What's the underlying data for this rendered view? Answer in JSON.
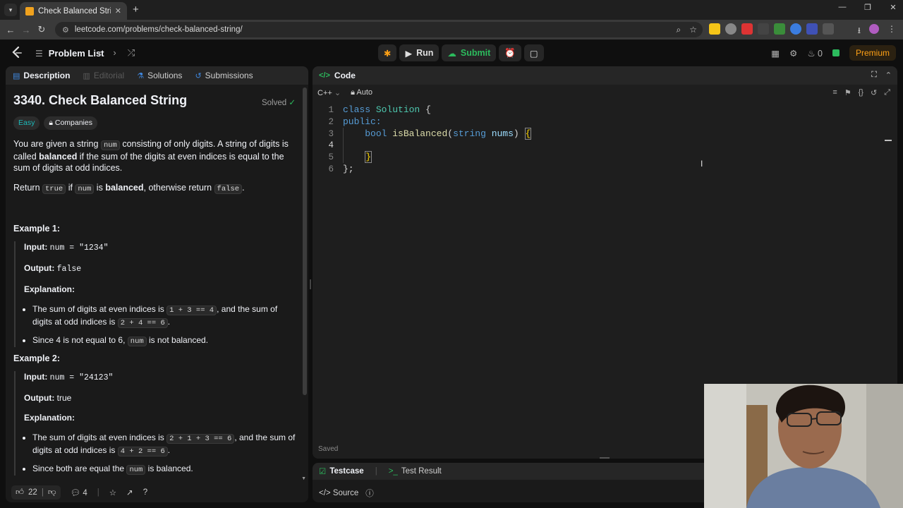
{
  "browser": {
    "tab_title": "Check Balanced String - LeetCo",
    "url": "leetcode.com/problems/check-balanced-string/"
  },
  "nav": {
    "problem_list": "Problem List",
    "run": "Run",
    "submit": "Submit",
    "streak": "0",
    "premium": "Premium"
  },
  "left_tabs": {
    "description": "Description",
    "editorial": "Editorial",
    "solutions": "Solutions",
    "submissions": "Submissions"
  },
  "problem": {
    "title": "3340. Check Balanced String",
    "status": "Solved",
    "difficulty": "Easy",
    "companies": "Companies",
    "desc1_a": "You are given a string ",
    "desc1_code": "num",
    "desc1_b": " consisting of only digits. A string of digits is called ",
    "desc1_bold": "balanced",
    "desc1_c": " if the sum of the digits at even indices is equal to the sum of digits at odd indices.",
    "desc2_a": "Return ",
    "desc2_code1": "true",
    "desc2_b": " if ",
    "desc2_code2": "num",
    "desc2_c": " is ",
    "desc2_bold": "balanced",
    "desc2_d": ", otherwise return ",
    "desc2_code3": "false",
    "desc2_e": "."
  },
  "examples": [
    {
      "heading": "Example 1:",
      "input_label": "Input:",
      "input": "num = \"1234\"",
      "output_label": "Output:",
      "output": "false",
      "explanation_label": "Explanation:",
      "bullet1_a": "The sum of digits at even indices is ",
      "bullet1_code1": "1 + 3 == 4",
      "bullet1_b": ", and the sum of digits at odd indices is ",
      "bullet1_code2": "2 + 4 == 6",
      "bullet1_c": ".",
      "bullet2_a": "Since 4 is not equal to 6, ",
      "bullet2_code": "num",
      "bullet2_b": " is not balanced."
    },
    {
      "heading": "Example 2:",
      "input_label": "Input:",
      "input": "num = \"24123\"",
      "output_label": "Output:",
      "output": "true",
      "explanation_label": "Explanation:",
      "bullet1_a": "The sum of digits at even indices is ",
      "bullet1_code1": "2 + 1 + 3 == 6",
      "bullet1_b": ", and the sum of digits at odd indices is ",
      "bullet1_code2": "4 + 2 == 6",
      "bullet1_c": ".",
      "bullet2_a": "Since both are equal the ",
      "bullet2_code": "num",
      "bullet2_b": " is balanced."
    }
  ],
  "footer": {
    "likes": "22",
    "comments": "4"
  },
  "editor": {
    "panel_title": "Code",
    "language": "C++",
    "mode": "Auto",
    "line_numbers": [
      "1",
      "2",
      "3",
      "4",
      "5",
      "6"
    ],
    "l1_kw": "class",
    "l1_name": "Solution",
    "l1_brace": "{",
    "l2_kw": "public:",
    "l3_type": "bool",
    "l3_fn": "isBalanced",
    "l3_open": "(",
    "l3_ptype": "string",
    "l3_param": "nums",
    "l3_close": ")",
    "l3_brace": "{",
    "l5_brace": "}",
    "l6_text": "};",
    "saved": "Saved"
  },
  "bottom": {
    "testcase": "Testcase",
    "test_result": "Test Result",
    "source": "Source"
  },
  "colors": {
    "accent_green": "#2cbb5d",
    "easy_teal": "#1cbaba",
    "premium_orange": "#ffa116"
  }
}
